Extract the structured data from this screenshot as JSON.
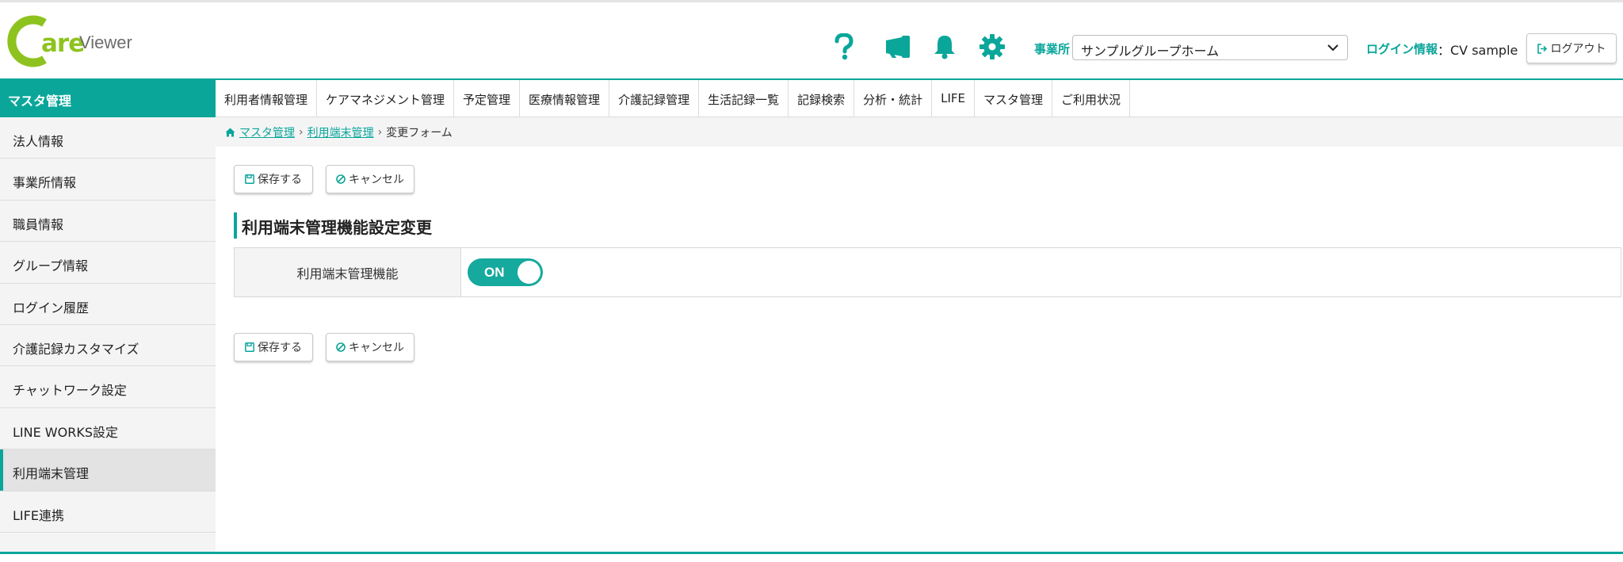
{
  "logo": {
    "c": "C",
    "are": "are",
    "viewer": "Viewer"
  },
  "header": {
    "office_label": "事業所",
    "office_selected": "サンプルグループホーム",
    "login_label": "ログイン情報",
    "login_user": "：CV sample",
    "logout_label": "ログアウト",
    "icons": [
      "help-icon",
      "megaphone-icon",
      "bell-icon",
      "gear-icon"
    ]
  },
  "sidebar": {
    "title": "マスタ管理",
    "items": [
      {
        "label": "法人情報"
      },
      {
        "label": "事業所情報"
      },
      {
        "label": "職員情報"
      },
      {
        "label": "グループ情報"
      },
      {
        "label": "ログイン履歴"
      },
      {
        "label": "介護記録カスタマイズ"
      },
      {
        "label": "チャットワーク設定"
      },
      {
        "label": "LINE WORKS設定"
      },
      {
        "label": "利用端末管理"
      },
      {
        "label": "LIFE連携"
      }
    ],
    "active": "利用端末管理"
  },
  "nav": {
    "items": [
      {
        "label": "利用者情報管理"
      },
      {
        "label": "ケアマネジメント管理"
      },
      {
        "label": "予定管理"
      },
      {
        "label": "医療情報管理"
      },
      {
        "label": "介護記録管理"
      },
      {
        "label": "生活記録一覧"
      },
      {
        "label": "記録検索"
      },
      {
        "label": "分析・統計"
      },
      {
        "label": "LIFE"
      },
      {
        "label": "マスタ管理"
      },
      {
        "label": "ご利用状況"
      }
    ]
  },
  "breadcrumb": {
    "items": [
      "マスタ管理",
      "利用端末管理"
    ],
    "current": "変更フォーム",
    "separator": "›"
  },
  "form": {
    "save_label": "保存する",
    "cancel_label": "キャンセル",
    "title": "利用端末管理機能設定変更",
    "setting_label": "利用端末管理機能",
    "toggle_text": "ON",
    "toggle_state": true
  },
  "colors": {
    "accent": "#0aa69a",
    "logo_green": "#8ec31f",
    "sidebar_bg": "#f4f4f5"
  }
}
